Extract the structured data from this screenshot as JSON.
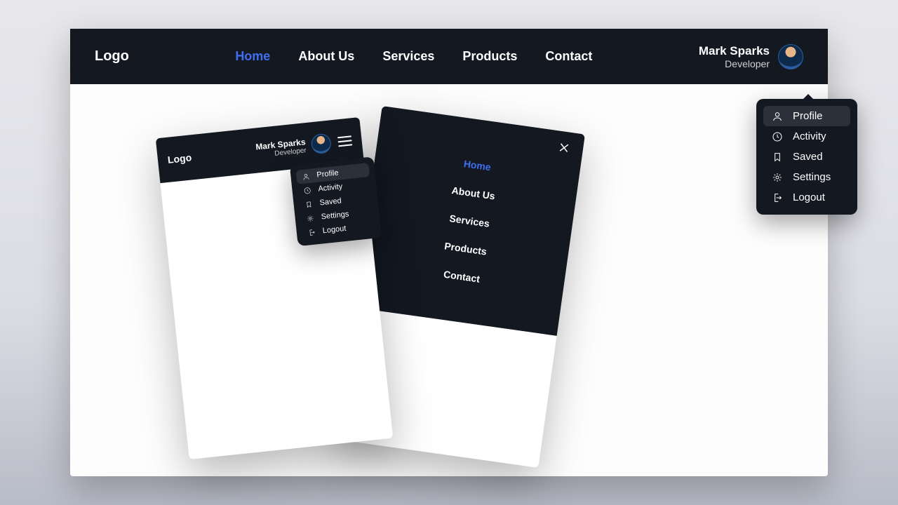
{
  "header": {
    "logo": "Logo",
    "nav": [
      "Home",
      "About Us",
      "Services",
      "Products",
      "Contact"
    ],
    "active": 0,
    "user": {
      "name": "Mark Sparks",
      "role": "Developer"
    }
  },
  "dropdown": {
    "items": [
      {
        "icon": "user",
        "label": "Profile"
      },
      {
        "icon": "clock",
        "label": "Activity"
      },
      {
        "icon": "bookmark",
        "label": "Saved"
      },
      {
        "icon": "gear",
        "label": "Settings"
      },
      {
        "icon": "logout",
        "label": "Logout"
      }
    ],
    "active": 0
  },
  "mobile": {
    "logo": "Logo",
    "user": {
      "name": "Mark Sparks",
      "role": "Developer"
    },
    "nav": [
      "Home",
      "About Us",
      "Services",
      "Products",
      "Contact"
    ],
    "active": 0
  }
}
